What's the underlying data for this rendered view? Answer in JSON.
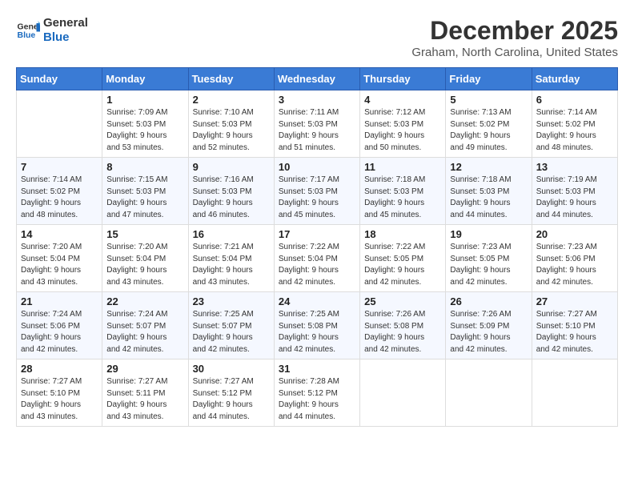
{
  "logo": {
    "line1": "General",
    "line2": "Blue"
  },
  "title": {
    "month_year": "December 2025",
    "location": "Graham, North Carolina, United States"
  },
  "days_of_week": [
    "Sunday",
    "Monday",
    "Tuesday",
    "Wednesday",
    "Thursday",
    "Friday",
    "Saturday"
  ],
  "weeks": [
    [
      {
        "day": "",
        "info": ""
      },
      {
        "day": "1",
        "info": "Sunrise: 7:09 AM\nSunset: 5:03 PM\nDaylight: 9 hours\nand 53 minutes."
      },
      {
        "day": "2",
        "info": "Sunrise: 7:10 AM\nSunset: 5:03 PM\nDaylight: 9 hours\nand 52 minutes."
      },
      {
        "day": "3",
        "info": "Sunrise: 7:11 AM\nSunset: 5:03 PM\nDaylight: 9 hours\nand 51 minutes."
      },
      {
        "day": "4",
        "info": "Sunrise: 7:12 AM\nSunset: 5:03 PM\nDaylight: 9 hours\nand 50 minutes."
      },
      {
        "day": "5",
        "info": "Sunrise: 7:13 AM\nSunset: 5:02 PM\nDaylight: 9 hours\nand 49 minutes."
      },
      {
        "day": "6",
        "info": "Sunrise: 7:14 AM\nSunset: 5:02 PM\nDaylight: 9 hours\nand 48 minutes."
      }
    ],
    [
      {
        "day": "7",
        "info": "Sunrise: 7:14 AM\nSunset: 5:02 PM\nDaylight: 9 hours\nand 48 minutes."
      },
      {
        "day": "8",
        "info": "Sunrise: 7:15 AM\nSunset: 5:03 PM\nDaylight: 9 hours\nand 47 minutes."
      },
      {
        "day": "9",
        "info": "Sunrise: 7:16 AM\nSunset: 5:03 PM\nDaylight: 9 hours\nand 46 minutes."
      },
      {
        "day": "10",
        "info": "Sunrise: 7:17 AM\nSunset: 5:03 PM\nDaylight: 9 hours\nand 45 minutes."
      },
      {
        "day": "11",
        "info": "Sunrise: 7:18 AM\nSunset: 5:03 PM\nDaylight: 9 hours\nand 45 minutes."
      },
      {
        "day": "12",
        "info": "Sunrise: 7:18 AM\nSunset: 5:03 PM\nDaylight: 9 hours\nand 44 minutes."
      },
      {
        "day": "13",
        "info": "Sunrise: 7:19 AM\nSunset: 5:03 PM\nDaylight: 9 hours\nand 44 minutes."
      }
    ],
    [
      {
        "day": "14",
        "info": "Sunrise: 7:20 AM\nSunset: 5:04 PM\nDaylight: 9 hours\nand 43 minutes."
      },
      {
        "day": "15",
        "info": "Sunrise: 7:20 AM\nSunset: 5:04 PM\nDaylight: 9 hours\nand 43 minutes."
      },
      {
        "day": "16",
        "info": "Sunrise: 7:21 AM\nSunset: 5:04 PM\nDaylight: 9 hours\nand 43 minutes."
      },
      {
        "day": "17",
        "info": "Sunrise: 7:22 AM\nSunset: 5:04 PM\nDaylight: 9 hours\nand 42 minutes."
      },
      {
        "day": "18",
        "info": "Sunrise: 7:22 AM\nSunset: 5:05 PM\nDaylight: 9 hours\nand 42 minutes."
      },
      {
        "day": "19",
        "info": "Sunrise: 7:23 AM\nSunset: 5:05 PM\nDaylight: 9 hours\nand 42 minutes."
      },
      {
        "day": "20",
        "info": "Sunrise: 7:23 AM\nSunset: 5:06 PM\nDaylight: 9 hours\nand 42 minutes."
      }
    ],
    [
      {
        "day": "21",
        "info": "Sunrise: 7:24 AM\nSunset: 5:06 PM\nDaylight: 9 hours\nand 42 minutes."
      },
      {
        "day": "22",
        "info": "Sunrise: 7:24 AM\nSunset: 5:07 PM\nDaylight: 9 hours\nand 42 minutes."
      },
      {
        "day": "23",
        "info": "Sunrise: 7:25 AM\nSunset: 5:07 PM\nDaylight: 9 hours\nand 42 minutes."
      },
      {
        "day": "24",
        "info": "Sunrise: 7:25 AM\nSunset: 5:08 PM\nDaylight: 9 hours\nand 42 minutes."
      },
      {
        "day": "25",
        "info": "Sunrise: 7:26 AM\nSunset: 5:08 PM\nDaylight: 9 hours\nand 42 minutes."
      },
      {
        "day": "26",
        "info": "Sunrise: 7:26 AM\nSunset: 5:09 PM\nDaylight: 9 hours\nand 42 minutes."
      },
      {
        "day": "27",
        "info": "Sunrise: 7:27 AM\nSunset: 5:10 PM\nDaylight: 9 hours\nand 42 minutes."
      }
    ],
    [
      {
        "day": "28",
        "info": "Sunrise: 7:27 AM\nSunset: 5:10 PM\nDaylight: 9 hours\nand 43 minutes."
      },
      {
        "day": "29",
        "info": "Sunrise: 7:27 AM\nSunset: 5:11 PM\nDaylight: 9 hours\nand 43 minutes."
      },
      {
        "day": "30",
        "info": "Sunrise: 7:27 AM\nSunset: 5:12 PM\nDaylight: 9 hours\nand 44 minutes."
      },
      {
        "day": "31",
        "info": "Sunrise: 7:28 AM\nSunset: 5:12 PM\nDaylight: 9 hours\nand 44 minutes."
      },
      {
        "day": "",
        "info": ""
      },
      {
        "day": "",
        "info": ""
      },
      {
        "day": "",
        "info": ""
      }
    ]
  ]
}
